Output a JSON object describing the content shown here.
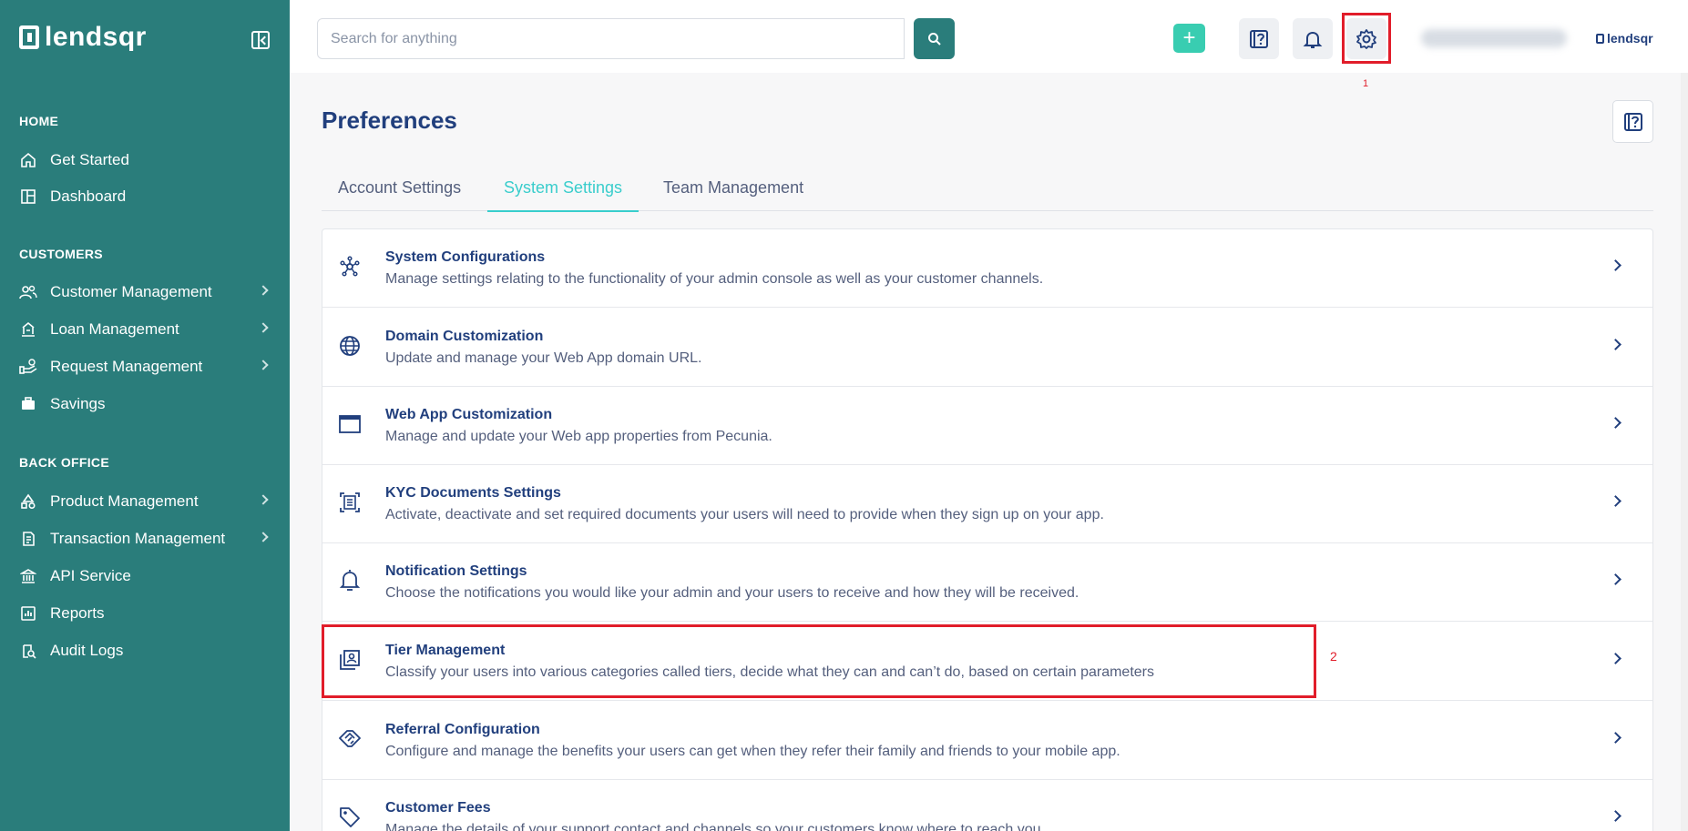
{
  "brand": {
    "name": "lendsqr"
  },
  "sidebar": {
    "sections": [
      {
        "title": "HOME"
      },
      {
        "title": "CUSTOMERS"
      },
      {
        "title": "BACK OFFICE"
      }
    ],
    "items": [
      {
        "label": "Get Started",
        "icon": "home-icon"
      },
      {
        "label": "Dashboard",
        "icon": "dashboard-icon"
      },
      {
        "label": "Customer Management",
        "icon": "users-icon"
      },
      {
        "label": "Loan Management",
        "icon": "loan-icon"
      },
      {
        "label": "Request Management",
        "icon": "request-icon"
      },
      {
        "label": "Savings",
        "icon": "savings-icon"
      },
      {
        "label": "Product Management",
        "icon": "product-icon"
      },
      {
        "label": "Transaction Management",
        "icon": "transaction-icon"
      },
      {
        "label": "API Service",
        "icon": "bank-icon"
      },
      {
        "label": "Reports",
        "icon": "reports-icon"
      },
      {
        "label": "Audit Logs",
        "icon": "audit-icon"
      }
    ]
  },
  "topbar": {
    "search_placeholder": "Search for anything",
    "plus_label": "+",
    "annotation_1": "1"
  },
  "main": {
    "title": "Preferences",
    "tabs": [
      {
        "label": "Account Settings"
      },
      {
        "label": "System Settings"
      },
      {
        "label": "Team Management"
      }
    ],
    "rows": [
      {
        "title": "System Configurations",
        "desc": "Manage settings relating to the functionality of your admin console as well as your customer channels.",
        "icon": "network-icon"
      },
      {
        "title": "Domain Customization",
        "desc": "Update and manage your Web App domain URL.",
        "icon": "globe-icon"
      },
      {
        "title": "Web App Customization",
        "desc": "Manage and update your Web app properties from Pecunia.",
        "icon": "window-icon"
      },
      {
        "title": "KYC Documents Settings",
        "desc": "Activate, deactivate and set required documents your users will need to provide when they sign up on your app.",
        "icon": "document-scan-icon"
      },
      {
        "title": "Notification Settings",
        "desc": "Choose the notifications you would like your admin and your users to receive and how they will be received.",
        "icon": "bell-icon"
      },
      {
        "title": "Tier Management",
        "desc": "Classify your users into various categories called tiers, decide what they can and can’t do, based on certain parameters",
        "icon": "profile-card-icon"
      },
      {
        "title": "Referral Configuration",
        "desc": "Configure and manage the benefits your users can get when they refer their family and friends to your mobile app.",
        "icon": "handshake-icon"
      },
      {
        "title": "Customer Fees",
        "desc": "Manage the details of your support contact and channels so your customers know where to reach you.",
        "icon": "tag-icon"
      }
    ],
    "annotation_2": "2"
  },
  "colors": {
    "sidebar": "#2a7d7b",
    "accent": "#39cdcc",
    "primary_text": "#213f7d",
    "highlight": "#e11d2a"
  }
}
